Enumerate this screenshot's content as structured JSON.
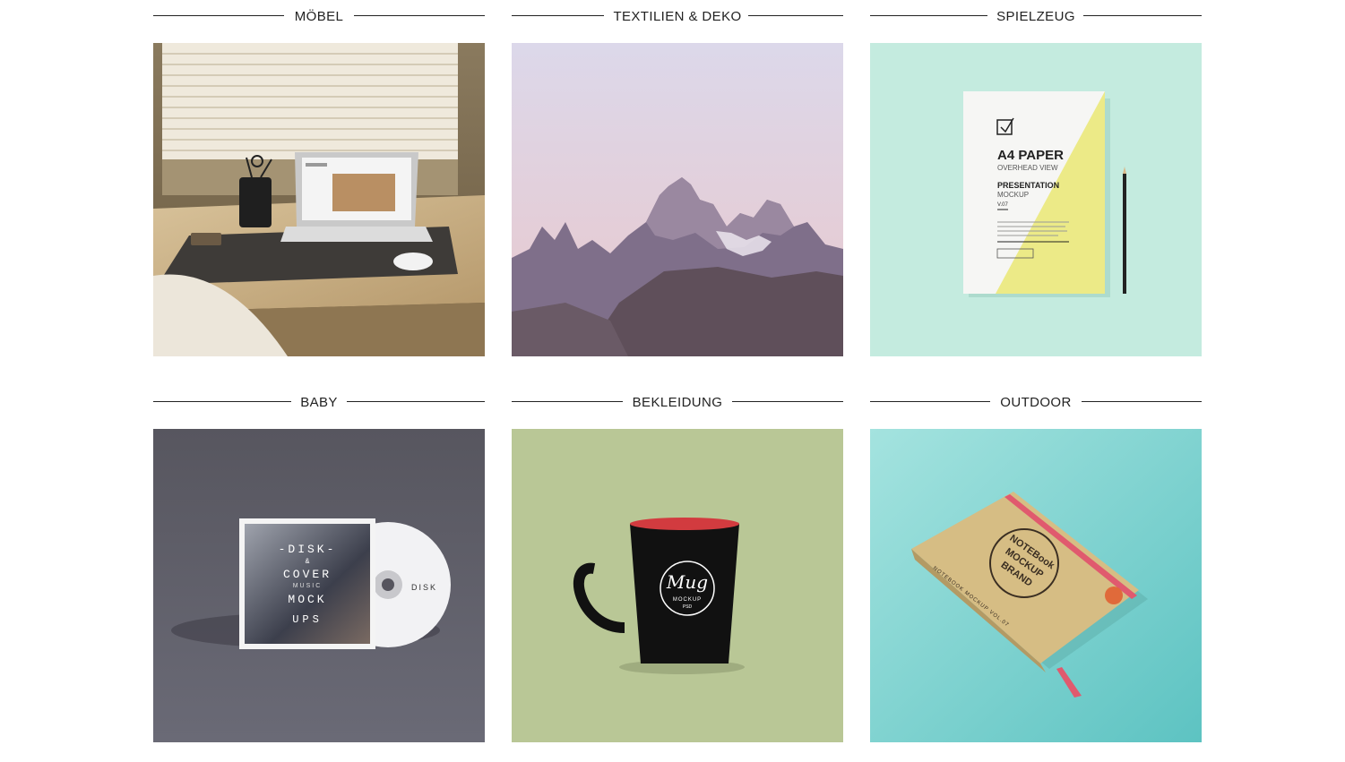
{
  "categories": [
    {
      "label": "MÖBEL"
    },
    {
      "label": "TEXTILIEN & DEKO"
    },
    {
      "label": "SPIELZEUG"
    },
    {
      "label": "BABY"
    },
    {
      "label": "BEKLEIDUNG"
    },
    {
      "label": "OUTDOOR"
    }
  ],
  "paper_mockup": {
    "title": "A4 PAPER",
    "subtitle": "OVERHEAD VIEW",
    "heading": "PRESENTATION",
    "heading2": "MOCKUP",
    "version": "V.07"
  },
  "disk_mockup": {
    "line1": "-DISK-",
    "line2": "&",
    "line3": "COVER",
    "line4": "MUSIC",
    "line5": "MOCK",
    "line6": "UPS",
    "disk_label": "DISK"
  },
  "mug_mockup": {
    "brand": "Mug",
    "sub": "MOCKUP",
    "tag": "PSD"
  },
  "notebook_mockup": {
    "line1": "NOTEBook",
    "line2": "MOCKUP",
    "line3": "BRAND",
    "spine": "NOTEBOOK MOCKUP VOL.07"
  },
  "colors": {
    "heading_line": "#222222",
    "mint_bg": "#bfe9dc",
    "sage_bg": "#b9c796",
    "teal_bg": "#7fd3d0",
    "slate_bg": "#5d5c68"
  }
}
